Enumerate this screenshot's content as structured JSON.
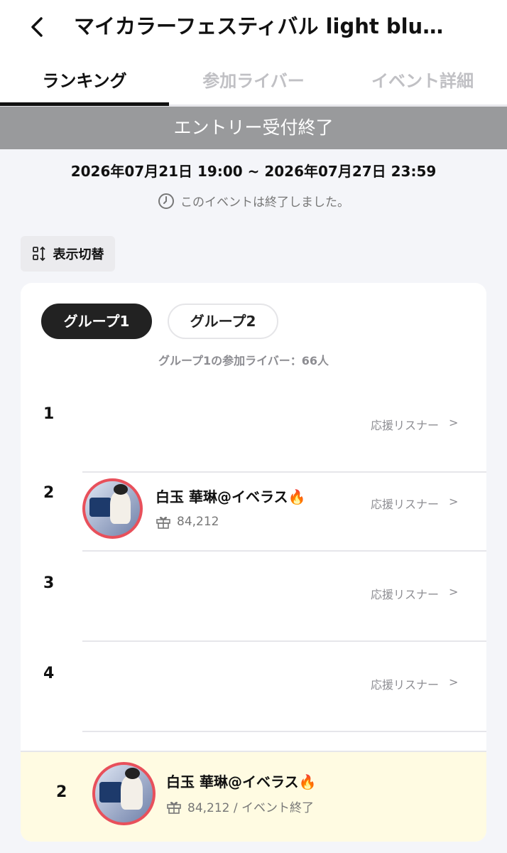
{
  "header": {
    "title": "マイカラーフェスティバル light blu…",
    "back_icon": "chevron-left-icon"
  },
  "tabs": [
    {
      "label": "ランキング",
      "active": true
    },
    {
      "label": "参加ライバー",
      "active": false
    },
    {
      "label": "イベント詳細",
      "active": false
    }
  ],
  "banner": {
    "text": "エントリー受付終了"
  },
  "period": {
    "range": "2026年07月21日 19:00 ~ 2026年07月27日 23:59",
    "status": "このイベントは終了しました。",
    "status_icon": "clock-icon"
  },
  "switch_button": {
    "label": "表示切替",
    "icon": "swap-layout-icon"
  },
  "groups": {
    "pills": [
      {
        "label": "グループ1",
        "active": true
      },
      {
        "label": "グループ2",
        "active": false
      }
    ],
    "participant_count": "グループ1の参加ライバー：66人"
  },
  "ranking": [
    {
      "rank": "1",
      "name": "",
      "score": "",
      "supporters_label": "応援リスナー"
    },
    {
      "rank": "2",
      "name": "白玉 華琳@イベラス🔥",
      "score": "84,212",
      "supporters_label": "応援リスナー"
    },
    {
      "rank": "3",
      "name": "",
      "score": "",
      "supporters_label": "応援リスナー"
    },
    {
      "rank": "4",
      "name": "",
      "score": "",
      "supporters_label": "応援リスナー"
    }
  ],
  "my_rank": {
    "rank": "2",
    "name": "白玉 華琳@イベラス🔥",
    "score": "84,212 / イベント終了"
  },
  "colors": {
    "banner_bg": "#999a9c",
    "avatar_ring": "#e8505b",
    "my_rank_bg": "#fffbe2",
    "active_pill": "#222222"
  }
}
